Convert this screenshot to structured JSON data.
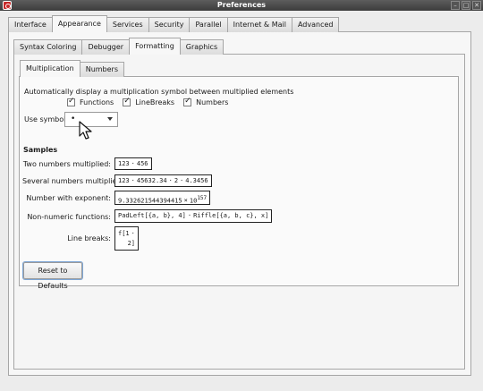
{
  "window": {
    "title": "Preferences",
    "min_glyph": "–",
    "max_glyph": "□",
    "close_glyph": "✕"
  },
  "top_tabs": [
    "Interface",
    "Appearance",
    "Services",
    "Security",
    "Parallel",
    "Internet & Mail",
    "Advanced"
  ],
  "appearance_tabs": [
    "Syntax Coloring",
    "Debugger",
    "Formatting",
    "Graphics"
  ],
  "formatting_tabs": [
    "Multiplication",
    "Numbers"
  ],
  "multiplication": {
    "description": "Automatically display a multiplication symbol between multiplied elements",
    "checkboxes": [
      {
        "label": "Functions",
        "checked": true
      },
      {
        "label": "LineBreaks",
        "checked": true
      },
      {
        "label": "Numbers",
        "checked": true
      }
    ],
    "use_symbol_label": "Use symbol:",
    "symbol_value": "•"
  },
  "samples": {
    "heading": "Samples",
    "rows": [
      {
        "label": "Two numbers multiplied:",
        "parts": [
          "123",
          "456"
        ]
      },
      {
        "label": "Several numbers multiplied:",
        "parts": [
          "123",
          "45632.34",
          "2",
          "4.3456"
        ]
      },
      {
        "label": "Number with exponent:",
        "mantissa": "9.332621544394415",
        "times": "×",
        "base": "10",
        "exponent": "157"
      },
      {
        "label": "Non-numeric functions:",
        "parts": [
          "PadLeft[{a, b}, 4]",
          "Riffle[{a, b, c}, x]"
        ]
      },
      {
        "label": "Line breaks:",
        "line1": "f[1",
        "line2": "2]"
      }
    ],
    "dot": "·"
  },
  "reset_button": "Reset to Defaults"
}
